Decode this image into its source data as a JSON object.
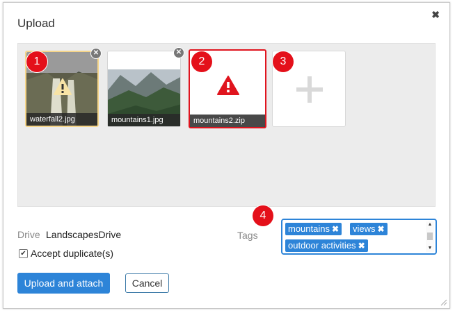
{
  "dialog": {
    "title": "Upload",
    "close_icon": "close-icon"
  },
  "files": [
    {
      "name": "waterfall2.jpg",
      "state": "selected-warning",
      "marker": "1"
    },
    {
      "name": "mountains1.jpg",
      "state": "normal"
    },
    {
      "name": "mountains2.zip",
      "state": "error",
      "marker": "2"
    }
  ],
  "add_tile": {
    "icon": "plus-icon",
    "marker": "3"
  },
  "form": {
    "drive_label": "Drive",
    "drive_value": "LandscapesDrive",
    "accept_duplicates_label": "Accept duplicate(s)",
    "accept_duplicates_checked": true,
    "tags_label": "Tags",
    "tags_marker": "4",
    "tags": [
      "mountains",
      "views",
      "outdoor activities"
    ]
  },
  "buttons": {
    "upload": "Upload and attach",
    "cancel": "Cancel"
  },
  "colors": {
    "accent": "#2d84d8",
    "error": "#e0141e",
    "warning": "#f5d58a"
  }
}
